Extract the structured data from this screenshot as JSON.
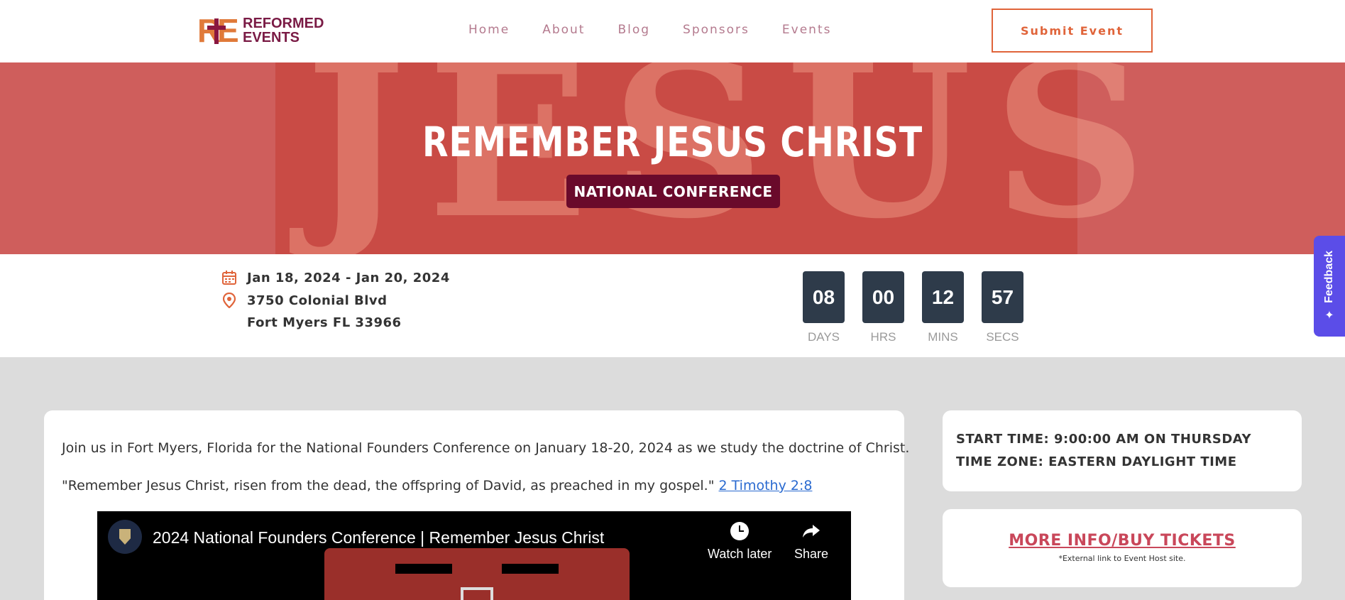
{
  "header": {
    "logo_text_line1": "REFORMED",
    "logo_text_line2": "EVENTS",
    "nav": [
      "Home",
      "About",
      "Blog",
      "Sponsors",
      "Events"
    ],
    "submit_label": "Submit Event"
  },
  "hero": {
    "background_word": "JESUS",
    "title": "REMEMBER JESUS CHRIST",
    "badge": "NATIONAL CONFERENCE"
  },
  "event": {
    "date_range": "Jan 18, 2024 - Jan 20, 2024",
    "address_line1": "3750 Colonial Blvd",
    "address_line2": "Fort Myers FL 33966"
  },
  "countdown": [
    {
      "value": "08",
      "label": "DAYS"
    },
    {
      "value": "00",
      "label": "HRS"
    },
    {
      "value": "12",
      "label": "MINS"
    },
    {
      "value": "57",
      "label": "SECS"
    }
  ],
  "feedback": {
    "label": "Feedback"
  },
  "description": {
    "paragraph1": "Join us in Fort Myers, Florida for the National Founders Conference on January 18-20, 2024 as we study the doctrine of Christ.",
    "paragraph2": "\"Remember Jesus Christ, risen from the dead, the offspring of David, as preached in my gospel.\"",
    "scripture_link": "2 Timothy 2:8"
  },
  "video": {
    "title": "2024 National Founders Conference | Remember Jesus Christ",
    "watch_later": "Watch later",
    "share": "Share"
  },
  "schedule": {
    "start_time": "START TIME: 9:00:00 AM ON THURSDAY",
    "time_zone": "TIME ZONE: EASTERN DAYLIGHT TIME"
  },
  "tickets": {
    "link_label": "MORE INFO/BUY TICKETS",
    "note": "*External link to Event Host site."
  },
  "colors": {
    "accent": "#e0643a",
    "brand": "#7a1b45",
    "hero_bg": "#c94b45",
    "badge_bg": "#6a0a2b",
    "countdown_bg": "#2e3b4a",
    "feedback_bg": "#5b4de8"
  }
}
